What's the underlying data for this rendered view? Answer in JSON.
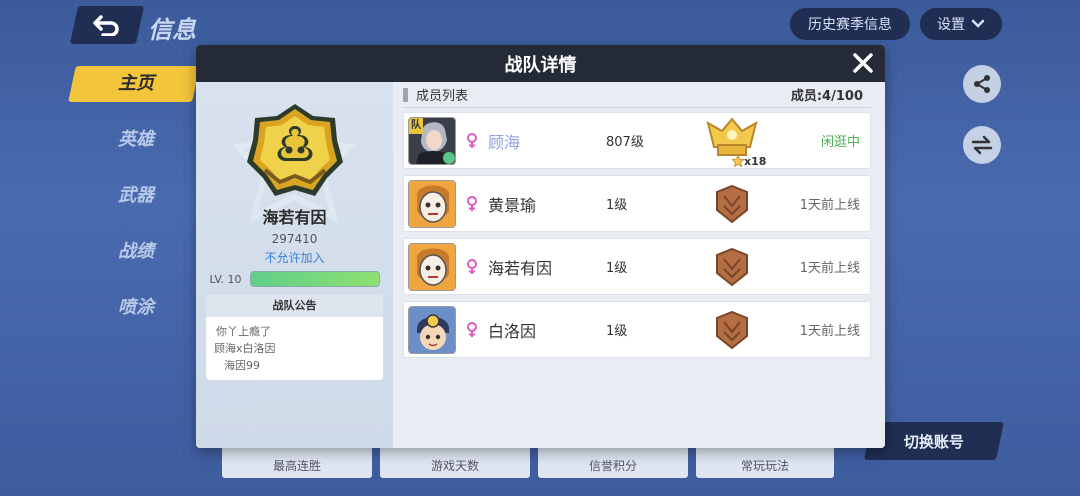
{
  "background": {
    "page_title": "信息",
    "nav": [
      "主页",
      "英雄",
      "武器",
      "战绩",
      "喷涂"
    ],
    "top_buttons": {
      "history": "历史赛季信息",
      "settings": "设置"
    },
    "switch_account": "切换账号",
    "bottom_tabs": [
      "最高连胜",
      "游戏天数",
      "信誉积分",
      "常玩玩法"
    ]
  },
  "modal": {
    "title": "战队详情",
    "team": {
      "name": "海若有因",
      "id": "297410",
      "join_status": "不允许加入",
      "level_label": "LV. 10",
      "level_progress": 1.0,
      "notice_title": "战队公告",
      "notice_lines": [
        "你丫上瘾了",
        "顾海x白洛因",
        "海因99"
      ]
    },
    "members_header": {
      "label": "成员列表",
      "count": "成员:4/100"
    },
    "members": [
      {
        "name": "顾海",
        "level": "807级",
        "status": "闲逛中",
        "rank": "gold",
        "rank_count": "x18",
        "captain_badge": "队"
      },
      {
        "name": "黄景瑜",
        "level": "1级",
        "status": "1天前上线",
        "rank": "bronze"
      },
      {
        "name": "海若有因",
        "level": "1级",
        "status": "1天前上线",
        "rank": "bronze"
      },
      {
        "name": "白洛因",
        "level": "1级",
        "status": "1天前上线",
        "rank": "bronze"
      }
    ]
  },
  "colors": {
    "accent_yellow": "#f3c53a",
    "modal_header": "#242a36",
    "online_green": "#4caf50",
    "female_pink": "#e05bbf",
    "link_blue": "#3b7fd9"
  }
}
